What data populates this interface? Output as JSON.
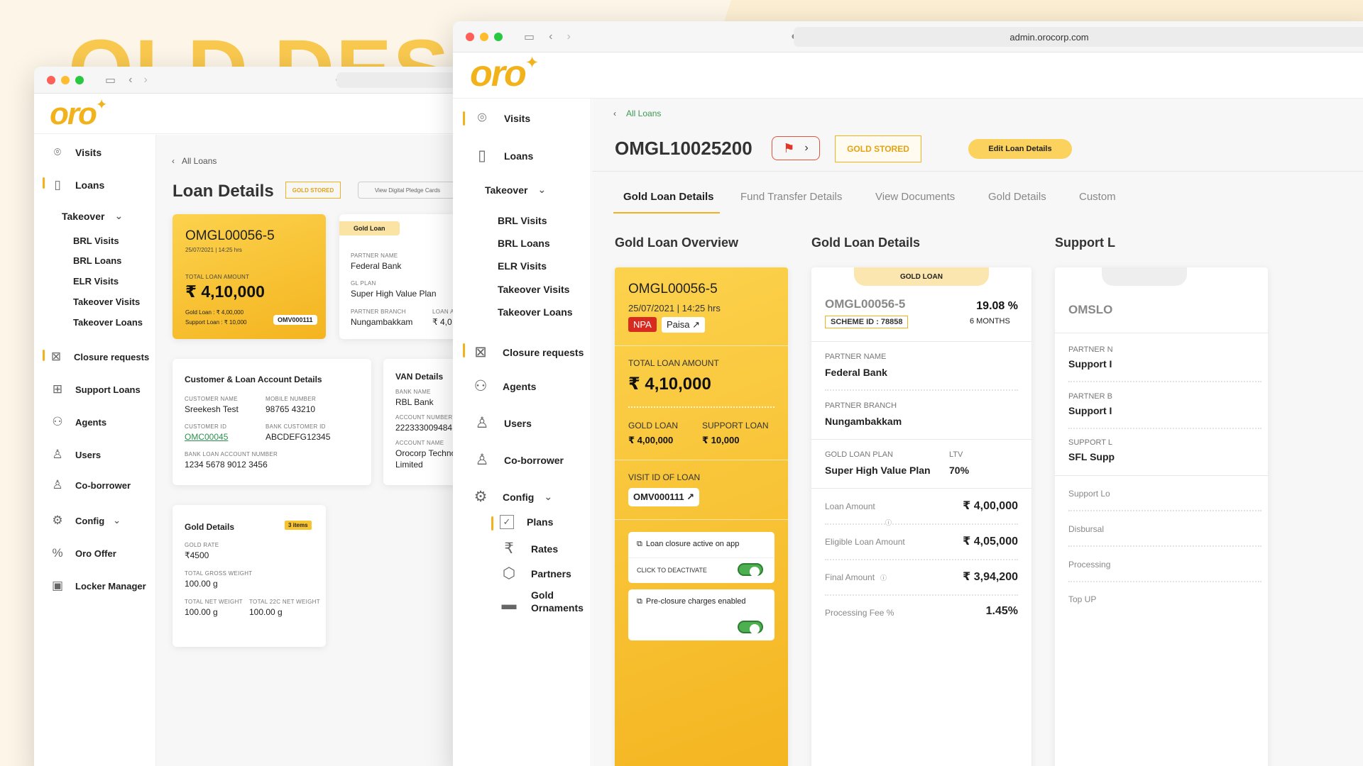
{
  "heading": "OLD DESIGN",
  "old": {
    "brand": "oro",
    "nav": {
      "visits": "Visits",
      "loans": "Loans",
      "takeover": "Takeover",
      "sub": [
        "BRL Visits",
        "BRL Loans",
        "ELR Visits",
        "Takeover Visits",
        "Takeover Loans"
      ],
      "closure": "Closure requests",
      "support": "Support Loans",
      "agents": "Agents",
      "users": "Users",
      "coborrower": "Co-borrower",
      "config": "Config",
      "offer": "Oro Offer",
      "locker": "Locker Manager"
    },
    "back": "All Loans",
    "title": "Loan Details",
    "gold_stored": "GOLD STORED",
    "pledge_btn": "View Digital Pledge Cards",
    "loan_card": {
      "id": "OMGL00056-5",
      "date": "25/07/2021 | 14:25 hrs",
      "total_label": "TOTAL LOAN AMOUNT",
      "total": "₹ 4,10,000",
      "gold_loan": "Gold Loan : ₹ 4,00,000",
      "support_loan": "Support Loan : ₹ 10,000",
      "visit": "OMV000111"
    },
    "gold_loan_card": {
      "tag": "Gold Loan",
      "partner_label": "PARTNER NAME",
      "partner": "Federal Bank",
      "plan_label": "GL PLAN",
      "plan": "Super High Value Plan",
      "branch_label": "PARTNER BRANCH",
      "branch": "Nungambakkam",
      "amount_label": "LOAN A",
      "amount": "₹ 4,0"
    },
    "customer": {
      "title": "Customer & Loan Account Details",
      "name_label": "CUSTOMER NAME",
      "name": "Sreekesh Test",
      "mobile_label": "MOBILE NUMBER",
      "mobile": "98765 43210",
      "id_label": "CUSTOMER ID",
      "id": "OMC00045",
      "bank_id_label": "BANK CUSTOMER ID",
      "bank_id": "ABCDEFG12345",
      "account_label": "BANK LOAN ACCOUNT NUMBER",
      "account": "1234 5678 9012 3456"
    },
    "van": {
      "title": "VAN Details",
      "bank_label": "BANK NAME",
      "bank": "RBL Bank",
      "acc_label": "ACCOUNT NUMBER",
      "acc": "222333009484",
      "accname_label": "ACCOUNT NAME",
      "accname1": "Orocorp Techno",
      "accname2": "Limited"
    },
    "gold": {
      "title": "Gold Details",
      "items": "3 items",
      "rate_label": "GOLD RATE",
      "rate": "₹4500",
      "gross_label": "TOTAL GROSS WEIGHT",
      "gross": "100.00 g",
      "net_label": "TOTAL NET WEIGHT",
      "net": "100.00 g",
      "net22_label": "TOTAL 22C NET WEIGHT",
      "net22": "100.00 g"
    }
  },
  "new": {
    "url": "admin.orocorp.com",
    "brand": "oro",
    "nav": {
      "visits": "Visits",
      "loans": "Loans",
      "takeover": "Takeover",
      "sub": [
        "BRL Visits",
        "BRL Loans",
        "ELR Visits",
        "Takeover Visits",
        "Takeover Loans"
      ],
      "closure": "Closure requests",
      "agents": "Agents",
      "users": "Users",
      "coborrower": "Co-borrower",
      "config": "Config",
      "plans": "Plans",
      "rates": "Rates",
      "partners": "Partners",
      "ornaments1": "Gold",
      "ornaments2": "Ornaments"
    },
    "back": "All Loans",
    "loan_id": "OMGL10025200",
    "gold_stored": "GOLD STORED",
    "edit": "Edit Loan Details",
    "tabs": [
      "Gold Loan Details",
      "Fund Transfer Details",
      "View Documents",
      "Gold Details",
      "Custom"
    ],
    "overview": {
      "title": "Gold Loan Overview",
      "id": "OMGL00056-5",
      "date": "25/07/2021 | 14:25 hrs",
      "npa": "NPA",
      "paisa": "Paisa ↗",
      "total_label": "TOTAL LOAN AMOUNT",
      "total": "₹ 4,10,000",
      "gold_label": "GOLD LOAN",
      "gold": "₹ 4,00,000",
      "support_label": "SUPPORT LOAN",
      "support": "₹ 10,000",
      "visit_label": "VISIT ID OF LOAN",
      "visit": "OMV000111 ↗",
      "closure_title": "Loan closure active on app",
      "closure_action": "CLICK TO DEACTIVATE",
      "preclosure_title": "Pre-closure charges enabled"
    },
    "details": {
      "title": "Gold Loan Details",
      "tag": "GOLD LOAN",
      "id": "OMGL00056-5",
      "scheme": "SCHEME ID : 78858",
      "rate": "19.08 %",
      "tenure": "6 MONTHS",
      "partner_label": "PARTNER NAME",
      "partner": "Federal Bank",
      "branch_label": "PARTNER BRANCH",
      "branch": "Nungambakkam",
      "plan_label": "GOLD LOAN PLAN",
      "plan": "Super High Value Plan",
      "ltv_label": "LTV",
      "ltv": "70%",
      "loan_amount_label": "Loan Amount",
      "loan_amount": "₹ 4,00,000",
      "eligible_label": "Eligible Loan Amount",
      "eligible": "₹ 4,05,000",
      "final_label": "Final Amount",
      "final": "₹ 3,94,200",
      "fee_label": "Processing Fee %",
      "fee": "1.45%"
    },
    "support": {
      "title": "Support L",
      "id": "OMSLO",
      "partner_label": "PARTNER N",
      "partner": "Support I",
      "partner_b_label": "PARTNER B",
      "partner_b": "Support I",
      "support_l_label": "SUPPORT L",
      "support_l": "SFL Supp",
      "items": [
        "Support Lo",
        "Disbursal",
        "Processing",
        "Top UP"
      ]
    }
  }
}
